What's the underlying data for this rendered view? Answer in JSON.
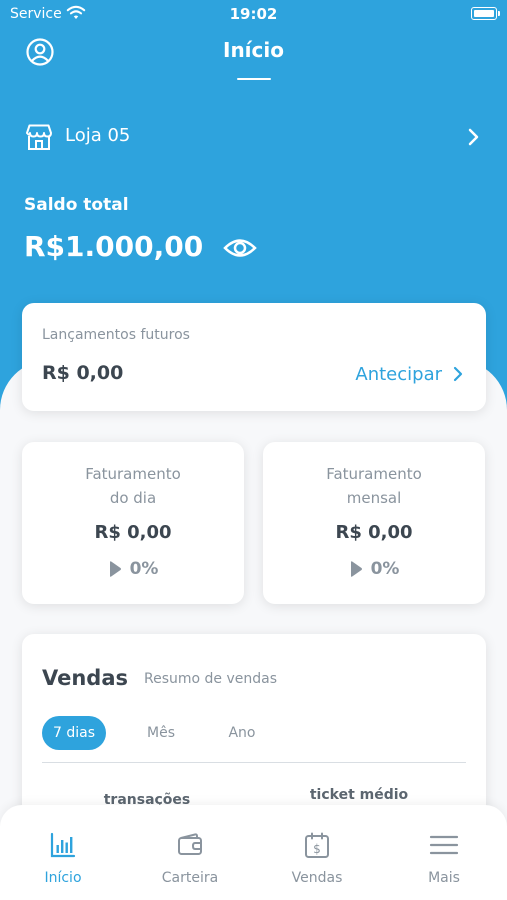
{
  "status_bar": {
    "carrier": "Service",
    "time": "19:02"
  },
  "header": {
    "title": "Início"
  },
  "store": {
    "name": "Loja 05"
  },
  "balance": {
    "label": "Saldo total",
    "value": "R$1.000,00"
  },
  "future": {
    "label": "Lançamentos futuros",
    "value": "R$ 0,00",
    "action_label": "Antecipar"
  },
  "billing_day": {
    "title_line1": "Faturamento",
    "title_line2": "do dia",
    "value": "R$ 0,00",
    "change": "0%"
  },
  "billing_month": {
    "title_line1": "Faturamento",
    "title_line2": "mensal",
    "value": "R$ 0,00",
    "change": "0%"
  },
  "sales": {
    "title": "Vendas",
    "subtitle": "Resumo de vendas",
    "periods": [
      "7 dias",
      "Mês",
      "Ano"
    ],
    "selected_period": "7 dias",
    "metric_transactions": "transações",
    "metric_ticket": "ticket médio"
  },
  "tabbar": {
    "items": [
      {
        "label": "Início",
        "icon": "bar-chart-icon",
        "active": true
      },
      {
        "label": "Carteira",
        "icon": "wallet-icon",
        "active": false
      },
      {
        "label": "Vendas",
        "icon": "calendar-dollar-icon",
        "active": false
      },
      {
        "label": "Mais",
        "icon": "menu-icon",
        "active": false
      }
    ]
  },
  "colors": {
    "primary": "#2ea3dd",
    "background": "#f7f8fa",
    "text_dark": "#3c4650",
    "text_muted": "#8a949e"
  }
}
